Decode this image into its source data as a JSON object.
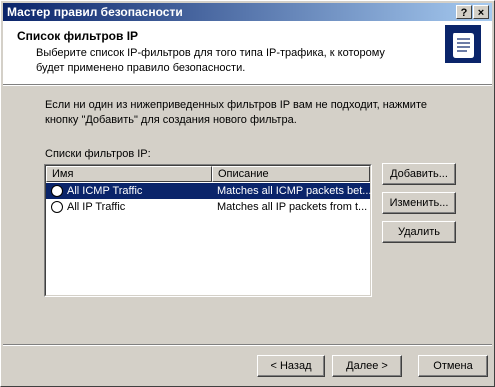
{
  "window": {
    "title": "Мастер правил безопасности",
    "help_label": "?",
    "close_label": "×"
  },
  "header": {
    "title": "Список фильтров IP",
    "subtitle": "Выберите список IP-фильтров для того типа IP-трафика, к которому будет применено правило безопасности.",
    "icon": "scroll-icon"
  },
  "info_text": "Если ни один из нижеприведенных фильтров IP вам не подходит, нажмите кнопку \"Добавить\" для создания нового фильтра.",
  "list_label": "Списки фильтров IP:",
  "columns": [
    "Имя",
    "Описание"
  ],
  "rows": [
    {
      "name": "All ICMP Traffic",
      "description": "Matches all ICMP packets bet...",
      "selected": true
    },
    {
      "name": "All IP Traffic",
      "description": "Matches all IP packets from t...",
      "selected": false
    }
  ],
  "side_buttons": {
    "add": "Добавить...",
    "edit": "Изменить...",
    "delete": "Удалить"
  },
  "footer_buttons": {
    "back": "< Назад",
    "next": "Далее >",
    "cancel": "Отмена"
  }
}
